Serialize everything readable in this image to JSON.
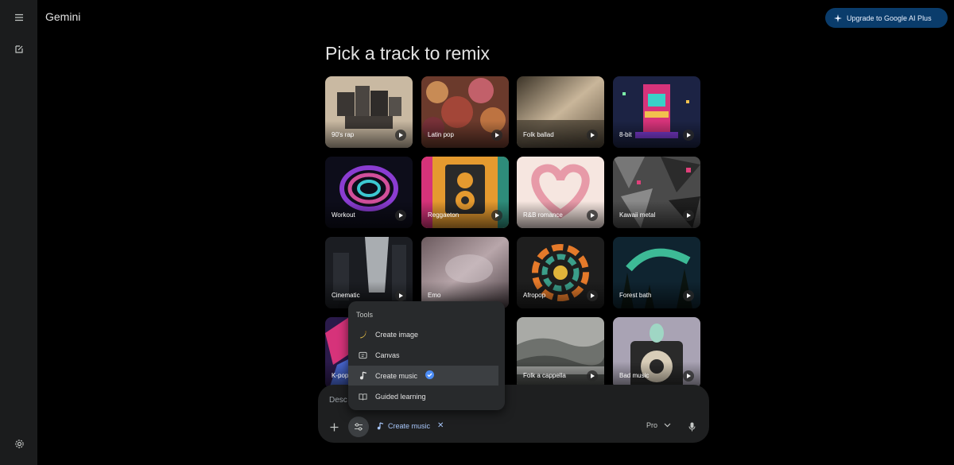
{
  "app": {
    "brand": "Gemini",
    "upgrade_label": "Upgrade to Google AI Plus"
  },
  "main": {
    "title": "Pick a track to remix"
  },
  "tracks": [
    {
      "label": "90's rap"
    },
    {
      "label": "Latin pop"
    },
    {
      "label": "Folk ballad"
    },
    {
      "label": "8-bit"
    },
    {
      "label": "Workout"
    },
    {
      "label": "Reggaeton"
    },
    {
      "label": "R&B romance"
    },
    {
      "label": "Kawaii metal"
    },
    {
      "label": "Cinematic"
    },
    {
      "label": "Emo"
    },
    {
      "label": "Afropop"
    },
    {
      "label": "Forest bath"
    },
    {
      "label": "K-pop"
    },
    {
      "label": "Folk a cappella"
    },
    {
      "label": "Bad music"
    }
  ],
  "tools_menu": {
    "title": "Tools",
    "items": [
      {
        "label": "Create image",
        "icon": "banana-icon"
      },
      {
        "label": "Canvas",
        "icon": "canvas-icon"
      },
      {
        "label": "Create music",
        "icon": "music-note-icon",
        "selected": true
      },
      {
        "label": "Guided learning",
        "icon": "book-icon"
      }
    ]
  },
  "prompt": {
    "placeholder": "Desc",
    "active_tool": "Create music",
    "model": "Pro"
  },
  "colors": {
    "accent": "#a8c7fa",
    "upgrade_bg": "#0a3c6b",
    "surface": "#1e1f20",
    "rail": "#1b1c1d"
  }
}
